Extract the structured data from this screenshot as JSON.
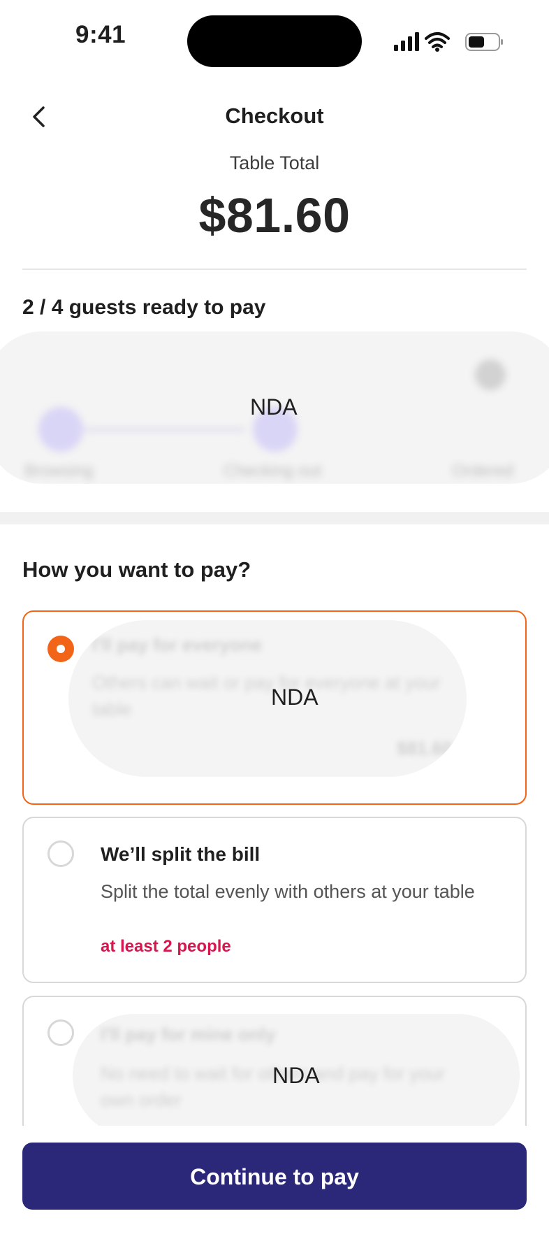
{
  "status_bar": {
    "time": "9:41"
  },
  "header": {
    "title": "Checkout"
  },
  "summary": {
    "label": "Table Total",
    "total": "$81.60"
  },
  "guests": {
    "ready_text": "2 / 4 guests ready to pay"
  },
  "progress": {
    "steps": [
      "Browsing",
      "Checking out",
      "Ordered"
    ],
    "nda_label": "NDA"
  },
  "payment": {
    "question": "How you want to pay?",
    "options": [
      {
        "title": "I'll pay for everyone",
        "description": "Others can wait or pay for everyone at your table",
        "amount": "$81.60",
        "selected": true,
        "nda_label": "NDA"
      },
      {
        "title": "We’ll split the bill",
        "description": "Split the total evenly with others at your table",
        "note": "at least 2 people",
        "selected": false
      },
      {
        "title": "I'll pay for mine only",
        "description": "No need to wait for others and pay for your own order",
        "selected": false,
        "nda_label": "NDA"
      }
    ]
  },
  "footer": {
    "cta_label": "Continue to pay"
  },
  "colors": {
    "accent": "#f26418",
    "primary": "#2b2779",
    "note": "#d6174e"
  }
}
